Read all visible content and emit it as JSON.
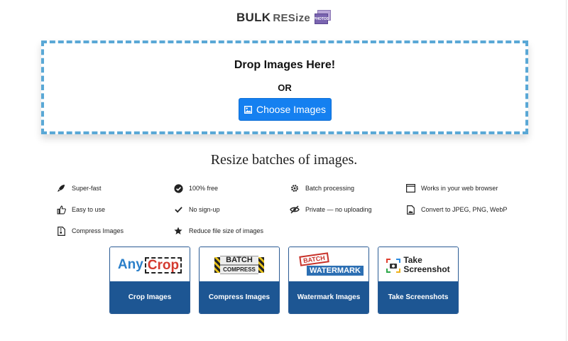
{
  "logo": {
    "bulk": "BULK",
    "resize": "RESize",
    "badge": "PHOTOS"
  },
  "dropzone": {
    "title": "Drop Images Here!",
    "or": "OR",
    "button_label": "Choose Images"
  },
  "tagline": "Resize batches of images.",
  "features": [
    {
      "icon": "rocket-icon",
      "label": "Super-fast"
    },
    {
      "icon": "check-badge-icon",
      "label": "100% free"
    },
    {
      "icon": "gear-icon",
      "label": "Batch processing"
    },
    {
      "icon": "browser-window-icon",
      "label": "Works in your web browser"
    },
    {
      "icon": "thumbs-up-icon",
      "label": "Easy to use"
    },
    {
      "icon": "checkmark-icon",
      "label": "No sign-up"
    },
    {
      "icon": "eye-slash-icon",
      "label": "Private — no uploading"
    },
    {
      "icon": "file-image-icon",
      "label": "Convert to JPEG, PNG, WebP"
    },
    {
      "icon": "file-archive-icon",
      "label": "Compress Images"
    },
    {
      "icon": "star-icon",
      "label": "Reduce file size of images"
    }
  ],
  "tools": [
    {
      "logo_a": "Any",
      "logo_b": "Crop",
      "label": "Crop Images"
    },
    {
      "logo_a": "BATCH",
      "logo_b": "COMPRESS",
      "label": "Compress Images"
    },
    {
      "logo_a": "BATCH",
      "logo_b": "WATERMARK",
      "label": "Watermark Images"
    },
    {
      "logo_a": "Take",
      "logo_b": "Screenshot",
      "label": "Take Screenshots"
    }
  ],
  "colors": {
    "accent": "#1580f0",
    "dashed_border": "#5aa8d6",
    "card_caption": "#1d5693"
  }
}
